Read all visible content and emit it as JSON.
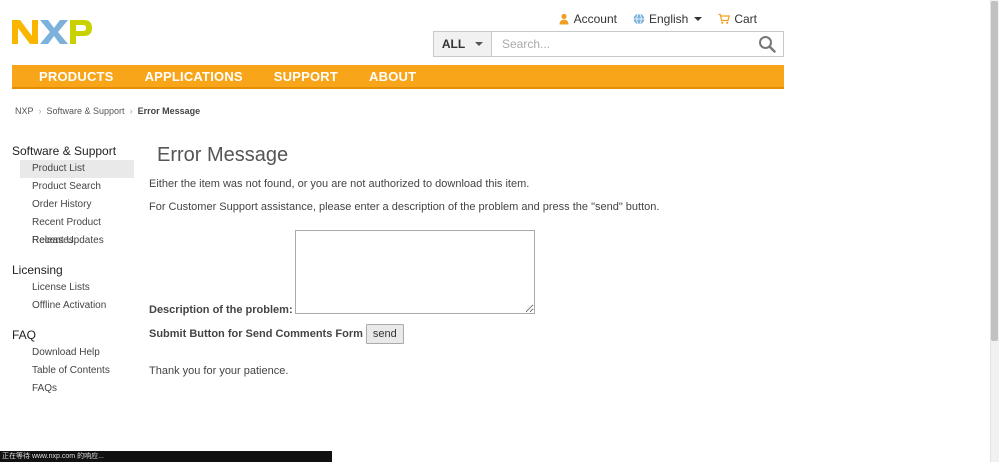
{
  "brand": {
    "logo_text": "NXP",
    "colors": {
      "accent": "#f9a51a",
      "logo_yellow": "#f9b500",
      "logo_blue": "#7bb1db",
      "logo_green": "#c9d200"
    }
  },
  "top_links": {
    "account": "Account",
    "language": "English",
    "cart": "Cart"
  },
  "search": {
    "category": "ALL",
    "placeholder": "Search..."
  },
  "nav": {
    "items": [
      "PRODUCTS",
      "APPLICATIONS",
      "SUPPORT",
      "ABOUT"
    ]
  },
  "breadcrumb": {
    "items": [
      "NXP",
      "Software & Support"
    ],
    "current": "Error Message"
  },
  "sidebar": {
    "sections": [
      {
        "title": "Software & Support",
        "items": [
          "Product List",
          "Product Search",
          "Order History",
          "Recent Product Releases",
          "Recent Updates"
        ]
      },
      {
        "title": "Licensing",
        "items": [
          "License Lists",
          "Offline Activation"
        ]
      },
      {
        "title": "FAQ",
        "items": [
          "Download Help",
          "Table of Contents",
          "FAQs"
        ]
      }
    ],
    "active_item": "Product List"
  },
  "main": {
    "title": "Error Message",
    "message1": "Either the item was not found, or you are not authorized to download this item.",
    "message2": "For Customer Support assistance, please enter a description of the problem and press the \"send\" button.",
    "description_label": "Description of the problem:",
    "description_value": "",
    "submit_label": "Submit Button for Send Comments Form",
    "send_button": "send",
    "thanks": "Thank you for your patience."
  },
  "status_bar": {
    "text": "正在等待 www.nxp.com 的响应..."
  }
}
